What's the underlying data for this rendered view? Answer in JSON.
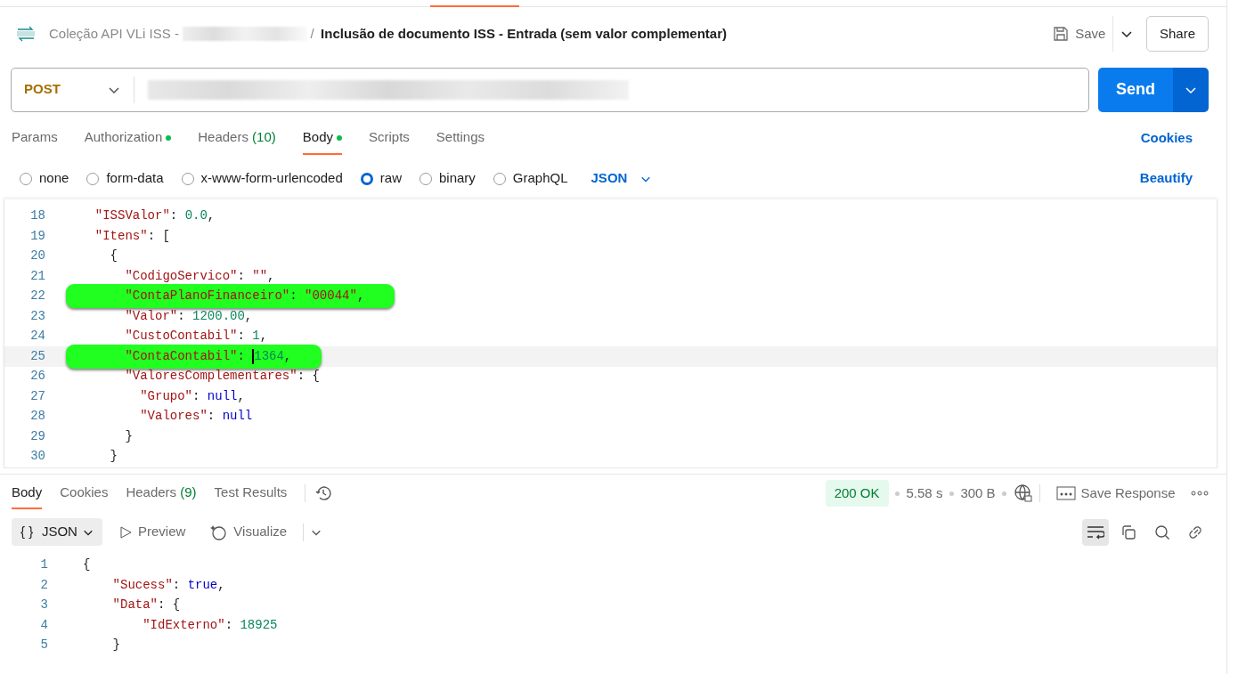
{
  "header": {
    "collection": "Coleção API VLi ISS -",
    "separator": "/",
    "request_name": "Inclusão de documento ISS - Entrada (sem valor complementar)",
    "save": "Save",
    "share": "Share"
  },
  "request": {
    "method": "POST",
    "send": "Send"
  },
  "request_tabs": [
    {
      "label": "Params",
      "selected": false,
      "dot": false
    },
    {
      "label": "Authorization",
      "selected": false,
      "dot": true
    },
    {
      "label": "Headers",
      "count": "(10)",
      "selected": false,
      "dot": false
    },
    {
      "label": "Body",
      "selected": true,
      "dot": true
    },
    {
      "label": "Scripts",
      "selected": false,
      "dot": false
    },
    {
      "label": "Settings",
      "selected": false,
      "dot": false
    }
  ],
  "cookies": "Cookies",
  "body_types": [
    {
      "label": "none",
      "selected": false
    },
    {
      "label": "form-data",
      "selected": false
    },
    {
      "label": "x-www-form-urlencoded",
      "selected": false
    },
    {
      "label": "raw",
      "selected": true
    },
    {
      "label": "binary",
      "selected": false
    },
    {
      "label": "GraphQL",
      "selected": false
    }
  ],
  "format": "JSON",
  "beautify": "Beautify",
  "editor_lines": [
    {
      "num": "18",
      "marked": false,
      "current": false,
      "tokens": [
        {
          "kind": "key",
          "text": "  \"ISSValor\""
        },
        {
          "kind": "punc",
          "text": ": "
        },
        {
          "kind": "num",
          "text": "0.0"
        },
        {
          "kind": "punc",
          "text": ","
        }
      ]
    },
    {
      "num": "19",
      "marked": false,
      "current": false,
      "tokens": [
        {
          "kind": "key",
          "text": "  \"Itens\""
        },
        {
          "kind": "punc",
          "text": ": ["
        }
      ]
    },
    {
      "num": "20",
      "marked": false,
      "current": false,
      "tokens": [
        {
          "kind": "punc",
          "text": "    {"
        }
      ]
    },
    {
      "num": "21",
      "marked": false,
      "current": false,
      "tokens": [
        {
          "kind": "key",
          "text": "      \"CodigoServico\""
        },
        {
          "kind": "punc",
          "text": ": "
        },
        {
          "kind": "str",
          "text": "\"\""
        },
        {
          "kind": "punc",
          "text": ","
        }
      ]
    },
    {
      "num": "22",
      "marked": true,
      "current": false,
      "tokens": [
        {
          "kind": "key",
          "text": "      \"ContaPlanoFinanceiro\""
        },
        {
          "kind": "punc",
          "text": ": "
        },
        {
          "kind": "str",
          "text": "\"00044\""
        },
        {
          "kind": "punc",
          "text": ","
        }
      ]
    },
    {
      "num": "23",
      "marked": false,
      "current": false,
      "tokens": [
        {
          "kind": "key",
          "text": "      \"Valor\""
        },
        {
          "kind": "punc",
          "text": ": "
        },
        {
          "kind": "num",
          "text": "1200.00"
        },
        {
          "kind": "punc",
          "text": ","
        }
      ]
    },
    {
      "num": "24",
      "marked": false,
      "current": false,
      "tokens": [
        {
          "kind": "key",
          "text": "      \"CustoContabil\""
        },
        {
          "kind": "punc",
          "text": ": "
        },
        {
          "kind": "num",
          "text": "1"
        },
        {
          "kind": "punc",
          "text": ","
        }
      ]
    },
    {
      "num": "25",
      "marked": true,
      "current": true,
      "tokens": [
        {
          "kind": "key",
          "text": "      \"ContaContabil\""
        },
        {
          "kind": "punc",
          "text": ": "
        },
        {
          "kind": "num",
          "text": "1364"
        },
        {
          "kind": "punc",
          "text": ","
        }
      ]
    },
    {
      "num": "26",
      "marked": false,
      "current": false,
      "tokens": [
        {
          "kind": "key",
          "text": "      \"ValoresComplementares\""
        },
        {
          "kind": "punc",
          "text": ": {"
        }
      ]
    },
    {
      "num": "27",
      "marked": false,
      "current": false,
      "tokens": [
        {
          "kind": "key",
          "text": "        \"Grupo\""
        },
        {
          "kind": "punc",
          "text": ": "
        },
        {
          "kind": "kw",
          "text": "null"
        },
        {
          "kind": "punc",
          "text": ","
        }
      ]
    },
    {
      "num": "28",
      "marked": false,
      "current": false,
      "tokens": [
        {
          "kind": "key",
          "text": "        \"Valores\""
        },
        {
          "kind": "punc",
          "text": ": "
        },
        {
          "kind": "kw",
          "text": "null"
        }
      ]
    },
    {
      "num": "29",
      "marked": false,
      "current": false,
      "tokens": [
        {
          "kind": "punc",
          "text": "      }"
        }
      ]
    },
    {
      "num": "30",
      "marked": false,
      "current": false,
      "tokens": [
        {
          "kind": "punc",
          "text": "    }"
        }
      ]
    }
  ],
  "response_tabs": [
    {
      "label": "Body",
      "selected": true
    },
    {
      "label": "Cookies",
      "selected": false
    },
    {
      "label": "Headers",
      "count": "(9)",
      "selected": false
    },
    {
      "label": "Test Results",
      "selected": false
    }
  ],
  "response_meta": {
    "status": "200 OK",
    "time": "5.58 s",
    "size": "300 B",
    "save_response": "Save Response"
  },
  "response_views": [
    {
      "label": "JSON",
      "icon": "{ }",
      "selected": true
    },
    {
      "label": "Preview",
      "selected": false
    },
    {
      "label": "Visualize",
      "selected": false
    }
  ],
  "wrap_on": true,
  "response_lines": [
    {
      "num": "1",
      "tokens": [
        {
          "kind": "punc",
          "text": "{"
        }
      ]
    },
    {
      "num": "2",
      "tokens": [
        {
          "kind": "key",
          "text": "    \"Sucess\""
        },
        {
          "kind": "punc",
          "text": ": "
        },
        {
          "kind": "kw",
          "text": "true"
        },
        {
          "kind": "punc",
          "text": ","
        }
      ]
    },
    {
      "num": "3",
      "tokens": [
        {
          "kind": "key",
          "text": "    \"Data\""
        },
        {
          "kind": "punc",
          "text": ": {"
        }
      ]
    },
    {
      "num": "4",
      "tokens": [
        {
          "kind": "key",
          "text": "        \"IdExterno\""
        },
        {
          "kind": "punc",
          "text": ": "
        },
        {
          "kind": "num",
          "text": "18925"
        }
      ]
    },
    {
      "num": "5",
      "tokens": [
        {
          "kind": "punc",
          "text": "    }"
        }
      ]
    }
  ]
}
